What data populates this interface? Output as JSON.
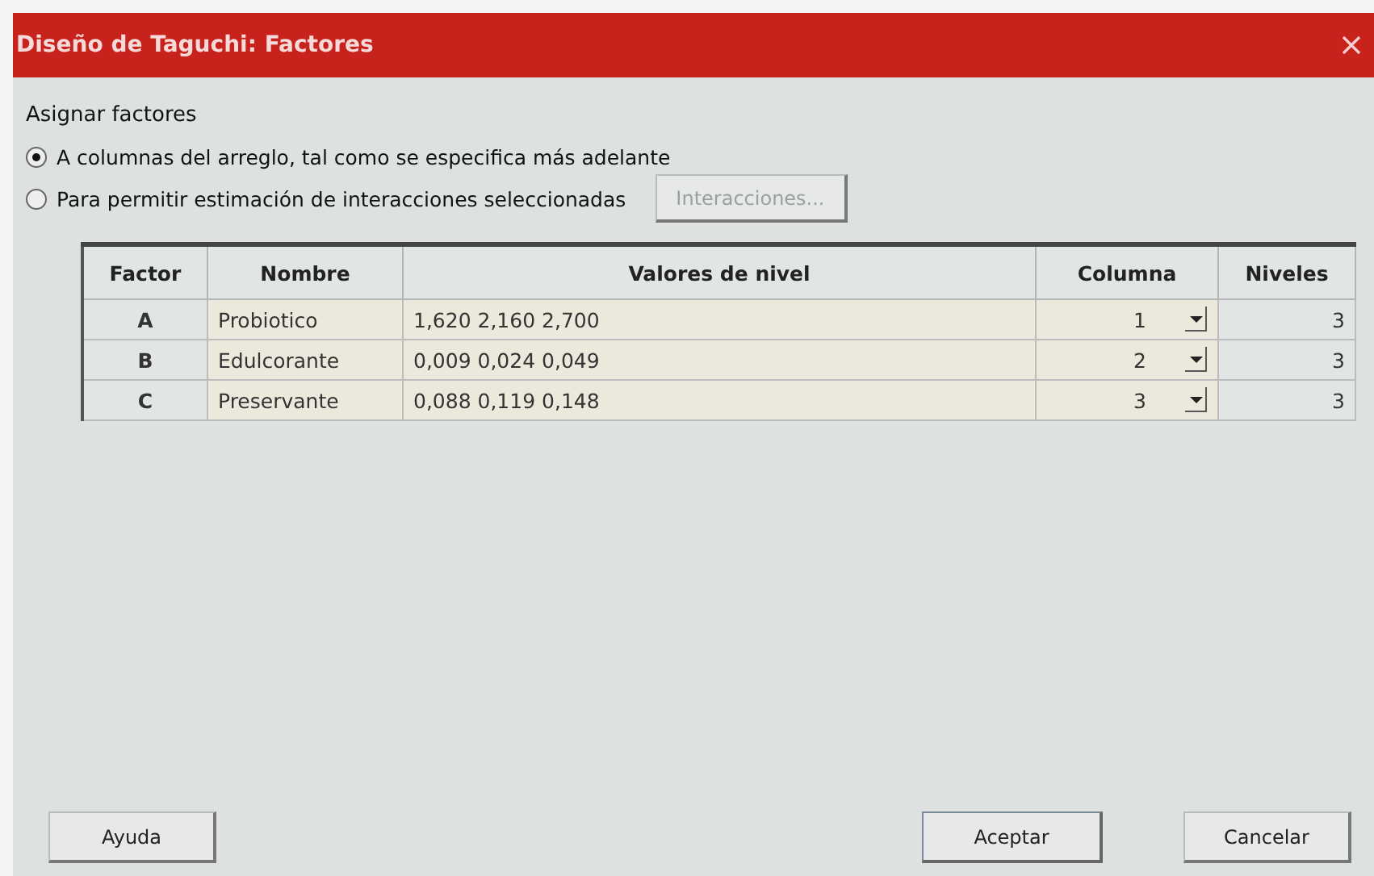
{
  "window": {
    "title": "Diseño de Taguchi: Factores"
  },
  "assign": {
    "label": "Asignar factores",
    "options": [
      {
        "label": "A columnas del arreglo, tal como se especifica más adelante",
        "selected": true
      },
      {
        "label": "Para permitir estimación de interacciones seleccionadas",
        "selected": false
      }
    ],
    "interactions_button": {
      "label": "Interacciones...",
      "disabled": true
    }
  },
  "table": {
    "columns": [
      "Factor",
      "Nombre",
      "Valores de nivel",
      "Columna",
      "Niveles"
    ],
    "rows": [
      {
        "factor": "A",
        "name": "Probiotico",
        "levels_values": "1,620 2,160 2,700",
        "column": "1",
        "levels": "3"
      },
      {
        "factor": "B",
        "name": "Edulcorante",
        "levels_values": "0,009 0,024 0,049",
        "column": "2",
        "levels": "3"
      },
      {
        "factor": "C",
        "name": "Preservante",
        "levels_values": "0,088 0,119 0,148",
        "column": "3",
        "levels": "3"
      }
    ]
  },
  "buttons": [
    {
      "label": "Ayuda",
      "kind": "help"
    },
    {
      "label": "Aceptar",
      "kind": "ok"
    },
    {
      "label": "Cancelar",
      "kind": "cancel"
    }
  ]
}
